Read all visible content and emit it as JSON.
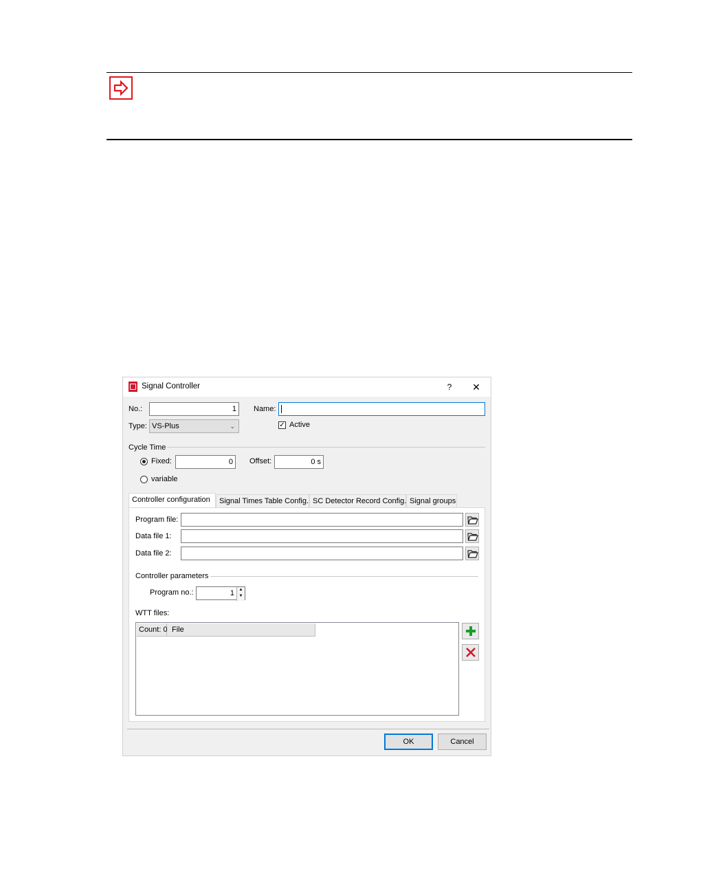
{
  "dialog": {
    "title": "Signal Controller",
    "help": "?",
    "close": "✕",
    "no_label": "No.:",
    "no_value": "1",
    "name_label": "Name:",
    "name_value": "",
    "type_label": "Type:",
    "type_value": "VS-Plus",
    "active_label": "Active",
    "active_checked": true,
    "cycle_time_label": "Cycle Time",
    "fixed_label": "Fixed:",
    "fixed_selected": true,
    "fixed_value": "0",
    "offset_label": "Offset:",
    "offset_value": "0 s",
    "variable_label": "variable",
    "tabs": [
      {
        "label": "Controller configuration",
        "active": true
      },
      {
        "label": "Signal Times Table Config.",
        "active": false
      },
      {
        "label": "SC Detector Record Config.",
        "active": false
      },
      {
        "label": "Signal groups",
        "active": false
      }
    ],
    "program_file_label": "Program file:",
    "program_file_value": "",
    "data_file1_label": "Data file 1:",
    "data_file1_value": "",
    "data_file2_label": "Data file 2:",
    "data_file2_value": "",
    "controller_params_label": "Controller parameters",
    "program_no_label": "Program no.:",
    "program_no_value": "1",
    "wtt_files_label": "WTT files:",
    "wtt_columns": [
      "Count: 0",
      "File"
    ],
    "ok_label": "OK",
    "cancel_label": "Cancel"
  },
  "colors": {
    "note_red": "#e0161e",
    "accent": "#0078d7",
    "add_green": "#1a9c2a",
    "remove_red": "#d3182e"
  },
  "icons": [
    "note-arrow-icon",
    "app-icon",
    "folder-open-icon",
    "add-icon",
    "delete-icon",
    "check-icon"
  ]
}
